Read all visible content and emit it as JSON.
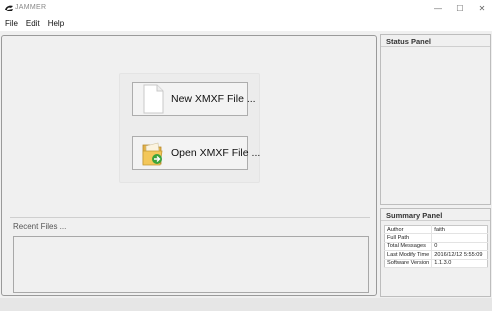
{
  "window": {
    "title": "JAMMER",
    "minimize_glyph": "—",
    "maximize_glyph": "☐",
    "close_glyph": "✕"
  },
  "menu": {
    "file": "File",
    "edit": "Edit",
    "help": "Help"
  },
  "main": {
    "new_button_label": "New XMXF File ...",
    "open_button_label": "Open XMXF File ...",
    "new_button_icon": "blank-document-icon",
    "open_button_icon": "folder-open-icon",
    "recent_files_label": "Recent Files ..."
  },
  "status_panel": {
    "title": "Status Panel"
  },
  "summary_panel": {
    "title": "Summary Panel",
    "rows": [
      {
        "key": "Author",
        "value": "faith"
      },
      {
        "key": "Full Path",
        "value": ""
      },
      {
        "key": "Total Messages",
        "value": "0"
      },
      {
        "key": "Last Modify Time",
        "value": "2016/12/12 5:55:09"
      },
      {
        "key": "Software Version",
        "value": "1.1.3.0"
      }
    ]
  }
}
